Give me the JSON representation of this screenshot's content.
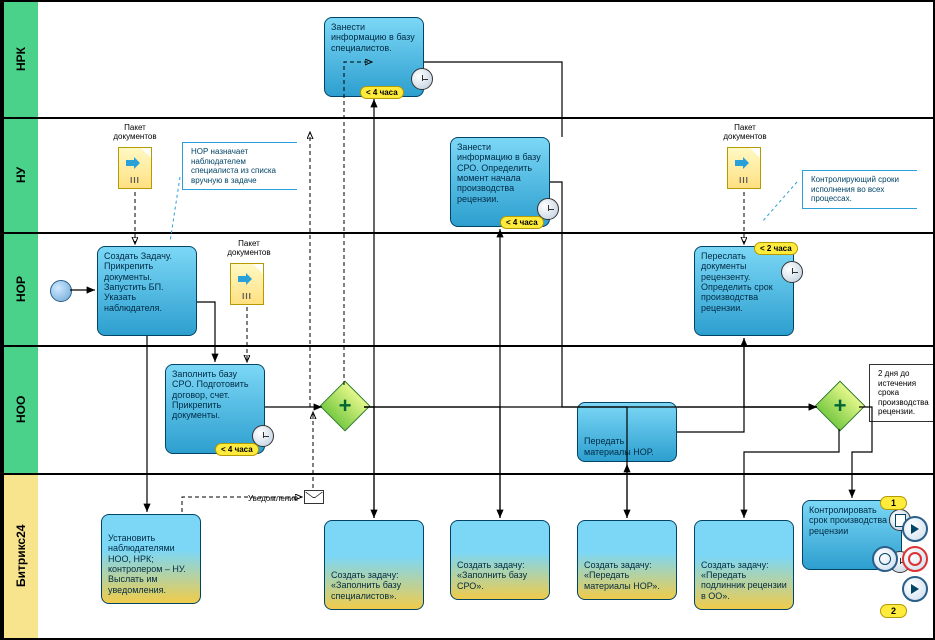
{
  "lanes": {
    "l1": "НРК",
    "l2": "НУ",
    "l3": "НОР",
    "l4": "НОО",
    "l5": "Битрикс24"
  },
  "tasks": {
    "t_nrk": "Занести информацию в базу специалистов.",
    "t_nu": "Занести информацию в базу СРО. Определить момент начала производства рецензии.",
    "t_nor_create": "Создать Задачу. Прикрепить документы. Запустить БП. Указать наблюдателя.",
    "t_nor_forward": "Переслать документы рецензенту. Определить срок производства рецензии.",
    "t_noo_fill": "Заполнить базу CPO. Подготовить договор, счет. Прикрепить документы.",
    "t_noo_send": "Передать материалы НОР.",
    "t_b24_observers": "Установить наблюдателями НОО, НРК; контролером – НУ. Выслать им уведомления.",
    "t_b24_spec": "Создать задачу: «Заполнить базу специалистов».",
    "t_b24_sro": "Создать задачу: «Заполнить базу СРО».",
    "t_b24_materials": "Создать задачу: «Передать материалы НОР».",
    "t_b24_original": "Создать задачу: «Передать подлинник рецензии в ОО».",
    "t_b24_control": "Контролировать срок производства рецензии"
  },
  "badges": {
    "lt4h_1": "< 4 часа",
    "lt4h_2": "< 4 часа",
    "lt4h_3": "< 4 часа",
    "lt2h": "< 2 часа",
    "pill1": "1",
    "pill2": "2"
  },
  "data_objects": {
    "docs1": "Пакет документов",
    "docs2": "Пакет документов",
    "docs3": "Пакет документов"
  },
  "notes": {
    "hop_note": "НОР назначает наблюдателем специалиста из списка вручную в задаче",
    "control_note": "Контролирующий сроки исполнения во всех процессах.",
    "deadline_note": "2 дня до истечения срока производства рецензии.",
    "notify": "Уведомление"
  },
  "icons": {
    "data_bars": "III"
  }
}
